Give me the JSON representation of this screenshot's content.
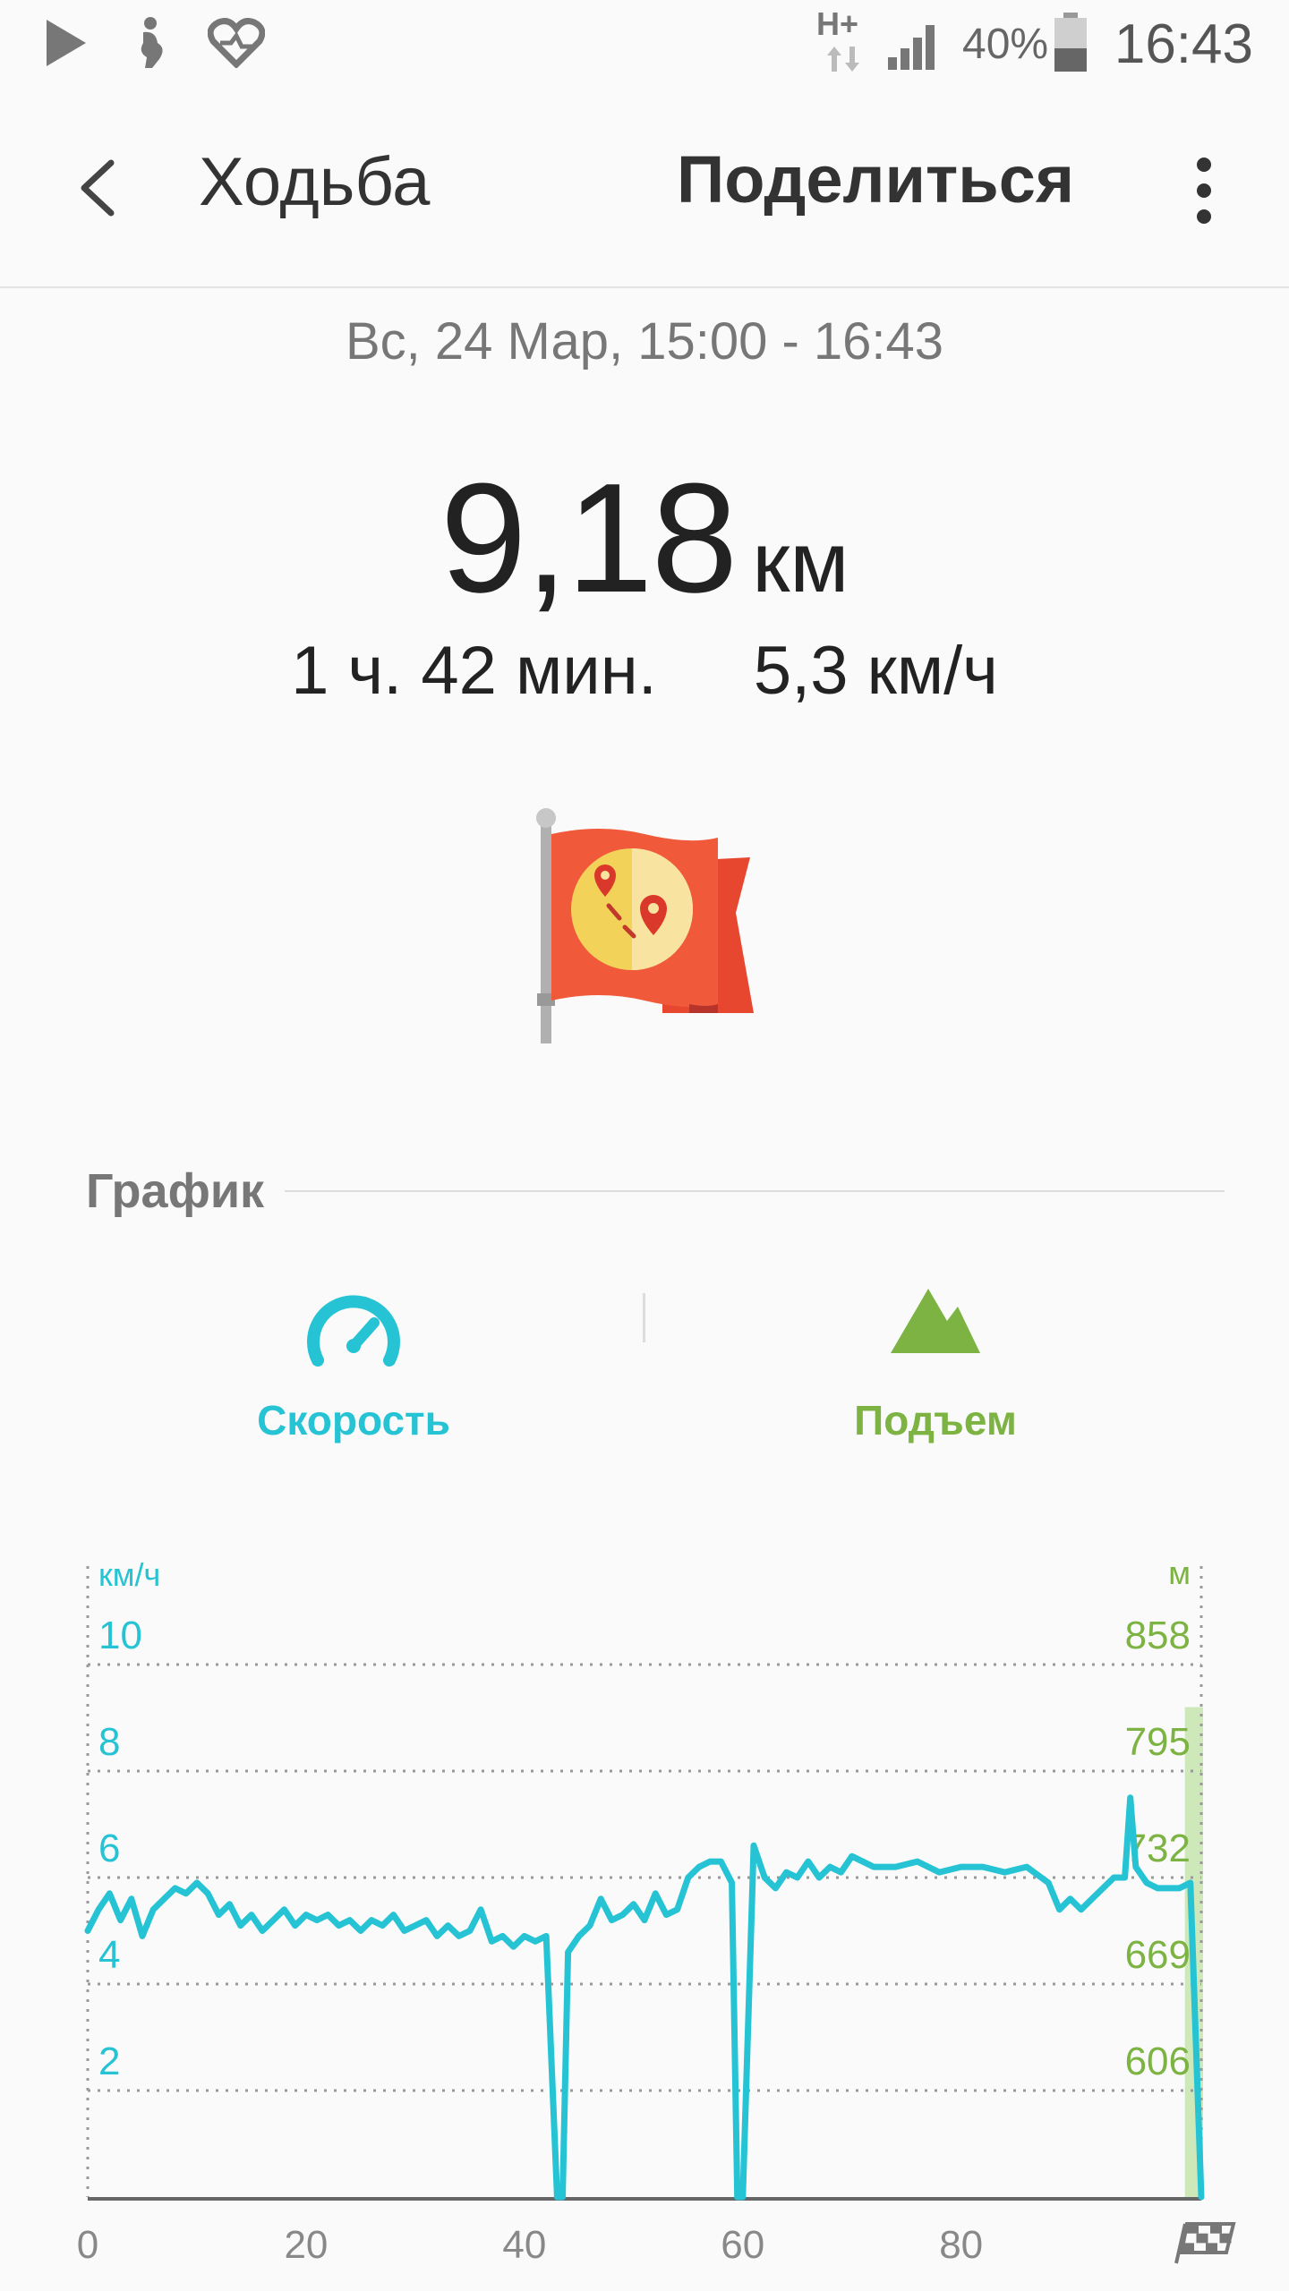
{
  "status_bar": {
    "time": "16:43",
    "battery_percent": "40%",
    "network": "H+",
    "icons": [
      "play-store-icon",
      "pregnancy-app-icon",
      "health-heart-icon",
      "network-h-plus-icon",
      "signal-icon",
      "battery-icon"
    ]
  },
  "app_bar": {
    "title": "Ходьба",
    "share_label": "Поделиться",
    "back_icon": "chevron-left-icon",
    "more_icon": "more-vert-icon"
  },
  "summary": {
    "date_range": "Вс, 24 Мар, 15:00 - 16:43",
    "distance_value": "9,18",
    "distance_unit": "км",
    "duration": "1 ч. 42 мин.",
    "avg_speed": "5,3 км/ч"
  },
  "graph": {
    "header": "График",
    "tabs": [
      {
        "label": "Скорость",
        "icon": "speedometer-icon",
        "color": "#25c3d3"
      },
      {
        "label": "Подъем",
        "icon": "mountain-icon",
        "color": "#7cb342"
      }
    ]
  },
  "chart_data": {
    "type": "line",
    "y_left_label": "км/ч",
    "y_right_label": "м",
    "y_left_ticks": [
      "10",
      "8",
      "6",
      "4",
      "2"
    ],
    "y_right_ticks": [
      "858",
      "795",
      "732",
      "669",
      "606"
    ],
    "x_ticks": [
      "0",
      "20",
      "40",
      "60",
      "80"
    ],
    "ylim": [
      0,
      10
    ],
    "xlim": [
      0,
      102
    ],
    "grid": true,
    "series": [
      {
        "color": "#25c3d3",
        "x": [
          0,
          1,
          2,
          3,
          4,
          5,
          6,
          7,
          8,
          9,
          10,
          11,
          12,
          13,
          14,
          15,
          16,
          17,
          18,
          19,
          20,
          21,
          22,
          23,
          24,
          25,
          26,
          27,
          28,
          29,
          30,
          31,
          32,
          33,
          34,
          35,
          36,
          37,
          38,
          39,
          40,
          41,
          42,
          43,
          43.5,
          44,
          45,
          46,
          47,
          48,
          49,
          50,
          51,
          52,
          53,
          54,
          55,
          56,
          57,
          58,
          59,
          59.5,
          60,
          61,
          62,
          63,
          64,
          65,
          66,
          67,
          68,
          69,
          70,
          72,
          74,
          76,
          78,
          80,
          82,
          84,
          86,
          88,
          89,
          90,
          91,
          92,
          93,
          94,
          95,
          95.5,
          96,
          97,
          98,
          99,
          100,
          101,
          102
        ],
        "values": [
          5.0,
          5.4,
          5.7,
          5.2,
          5.6,
          4.9,
          5.4,
          5.6,
          5.8,
          5.7,
          5.9,
          5.7,
          5.3,
          5.5,
          5.1,
          5.3,
          5.0,
          5.2,
          5.4,
          5.1,
          5.3,
          5.2,
          5.3,
          5.1,
          5.2,
          5.0,
          5.2,
          5.1,
          5.3,
          5.0,
          5.1,
          5.2,
          4.9,
          5.1,
          4.9,
          5.0,
          5.4,
          4.8,
          4.9,
          4.7,
          4.9,
          4.8,
          4.9,
          0.0,
          0.0,
          4.6,
          4.9,
          5.1,
          5.6,
          5.2,
          5.3,
          5.5,
          5.2,
          5.7,
          5.3,
          5.4,
          6.0,
          6.2,
          6.3,
          6.3,
          5.9,
          0.0,
          0.0,
          6.6,
          6.0,
          5.8,
          6.1,
          6.0,
          6.3,
          6.0,
          6.2,
          6.1,
          6.4,
          6.2,
          6.2,
          6.3,
          6.1,
          6.2,
          6.2,
          6.1,
          6.2,
          5.9,
          5.4,
          5.6,
          5.4,
          5.6,
          5.8,
          6.0,
          6.0,
          7.5,
          6.2,
          5.9,
          5.8,
          5.8,
          5.8,
          5.9,
          0.0
        ]
      }
    ]
  }
}
